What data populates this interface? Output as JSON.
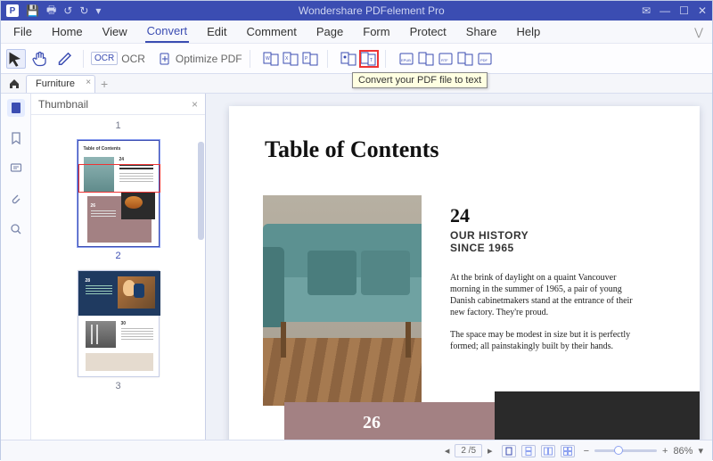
{
  "titlebar": {
    "title": "Wondershare PDFelement Pro",
    "quick_access": {
      "save": "💾",
      "print": "🖶",
      "undo": "↺",
      "redo": "↻",
      "dropdown": "▾"
    },
    "window": {
      "mail": "✉",
      "minimize": "—",
      "maximize": "☐",
      "close": "✕"
    }
  },
  "menu": {
    "items": [
      "File",
      "Home",
      "View",
      "Convert",
      "Edit",
      "Comment",
      "Page",
      "Form",
      "Protect",
      "Share",
      "Help"
    ],
    "active": "Convert",
    "collapse_icon": "⋁"
  },
  "toolbar": {
    "select": "▸",
    "hand": "✋",
    "edit": "✎",
    "ocr_box": "OCR",
    "ocr_label": "OCR",
    "optimize_icon": "📄",
    "optimize_label": "Optimize PDF",
    "tooltip": "Convert your PDF file to text"
  },
  "tabs": {
    "home": "⌂",
    "document": "Furniture",
    "close": "×",
    "add": "+"
  },
  "rail": {
    "thumbnails": "thumbnails-icon",
    "bookmarks": "bookmarks-icon",
    "comments": "comments-icon",
    "attachments": "attachments-icon",
    "search": "search-icon"
  },
  "panel": {
    "title": "Thumbnail",
    "close": "×",
    "pages": {
      "p1": "1",
      "p2": "2",
      "p3": "3"
    }
  },
  "document": {
    "title": "Table of Contents",
    "num_a": "24",
    "heading_a_line1": "OUR HISTORY",
    "heading_a_line2": "SINCE 1965",
    "para1": "At the brink of daylight on a quaint Vancouver morning in the summer of 1965, a pair of young Danish cabinetmakers stand at the entrance of their new factory. They're proud.",
    "para2": "The space may be modest in size but it is perfectly formed; all painstakingly built by their hands.",
    "num_b": "26"
  },
  "statusbar": {
    "page_indicator": "2 /5",
    "zoom_minus": "−",
    "zoom_plus": "+",
    "zoom_value": "86%",
    "zoom_dropdown": "▾"
  }
}
